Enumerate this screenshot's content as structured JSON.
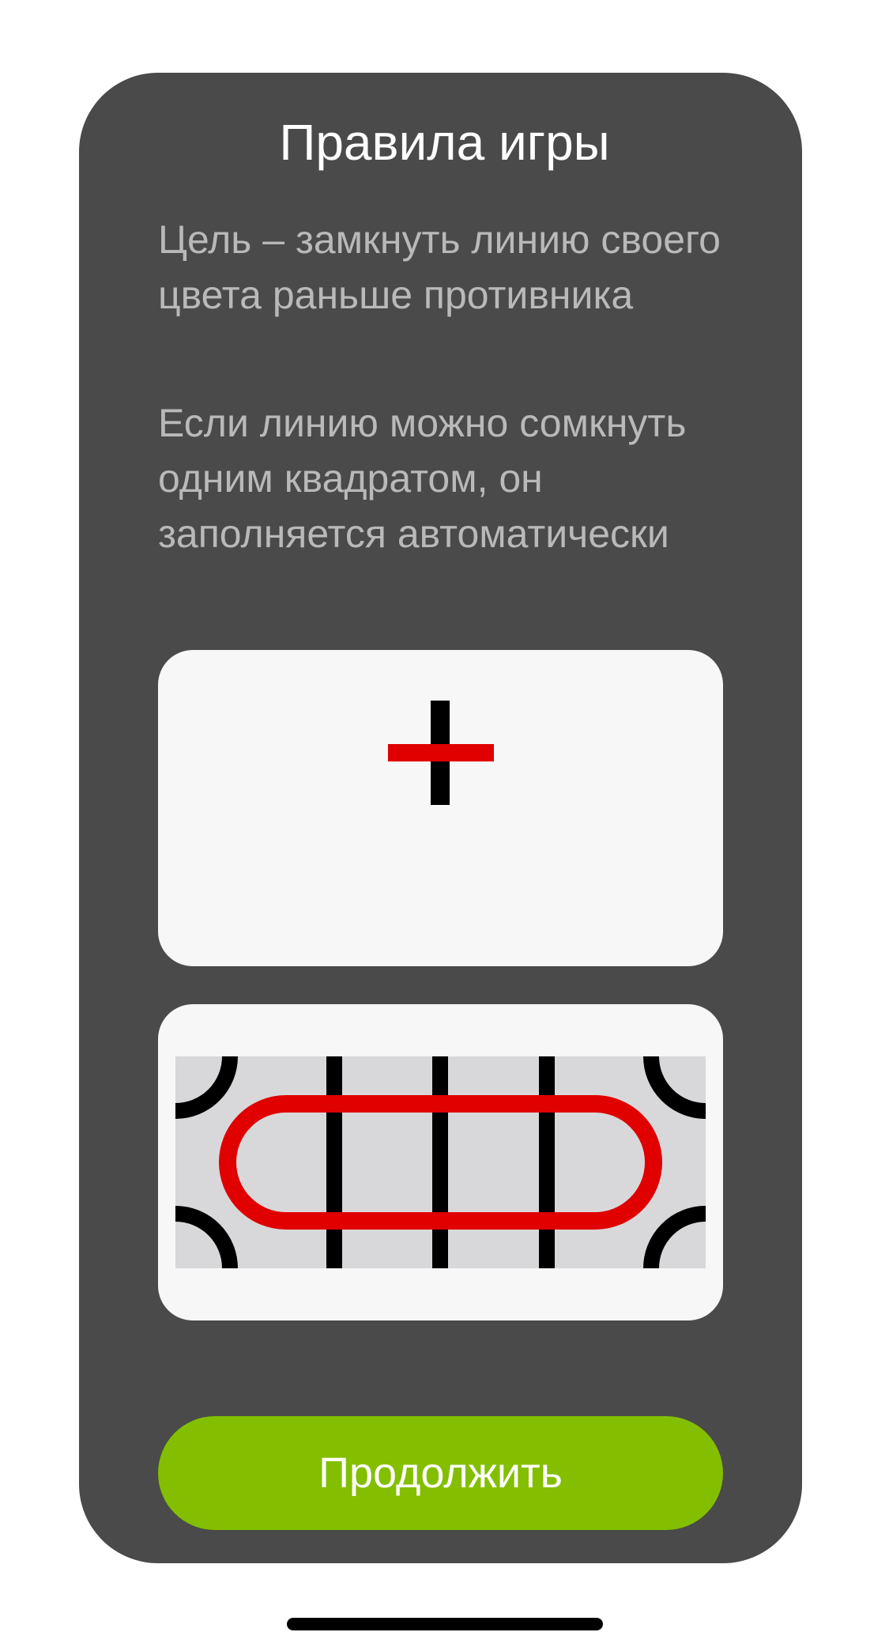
{
  "rules_screen": {
    "title": "Правила игры",
    "rule_goal": "Цель – замкнуть линию своего цвета раньше противника",
    "rule_autofill": "Если линию можно сомкнуть одним квадратом, он заполняется автоматически",
    "continue_label": "Продолжить"
  },
  "illustrations": {
    "cross_tile": {
      "icon": "cross-tile-icon",
      "horizontal_color": "#e00000",
      "vertical_color": "#000000"
    },
    "loop_board": {
      "icon": "closed-loop-board-icon",
      "loop_color": "#e00000",
      "line_color": "#000000",
      "board_color": "#d8d8da"
    }
  },
  "colors": {
    "panel": "#4a4a4a",
    "text_primary": "#ffffff",
    "text_secondary": "#b9b9b9",
    "accent": "#83bf00",
    "tile_background": "#f7f7f7"
  }
}
